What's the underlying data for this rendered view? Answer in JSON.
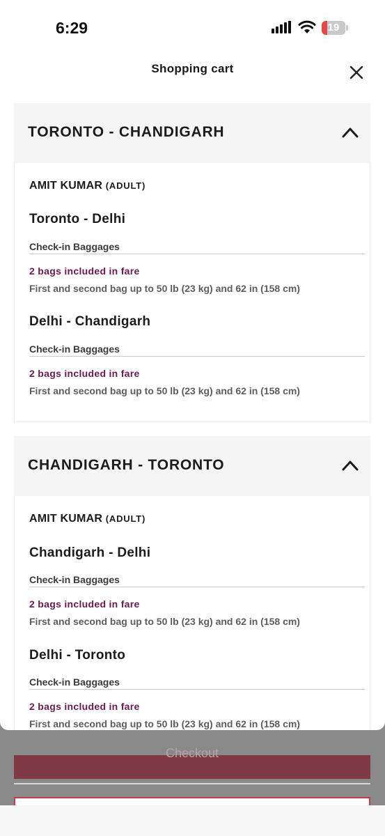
{
  "status_bar": {
    "time": "6:29",
    "battery": "19"
  },
  "sheet": {
    "title": "Shopping cart"
  },
  "sections": [
    {
      "route": "TORONTO - CHANDIGARH",
      "passenger": {
        "name": "AMIT KUMAR",
        "type": "(ADULT)"
      },
      "legs": [
        {
          "title": "Toronto - Delhi",
          "bag_label": "Check-in Baggages",
          "included": "2 bags included in fare",
          "detail": "First and second bag up to 50 lb (23 kg) and 62 in (158 cm)"
        },
        {
          "title": "Delhi - Chandigarh",
          "bag_label": "Check-in Baggages",
          "included": "2 bags included in fare",
          "detail": "First and second bag up to 50 lb (23 kg) and 62 in (158 cm)"
        }
      ]
    },
    {
      "route": "CHANDIGARH - TORONTO",
      "passenger": {
        "name": "AMIT KUMAR",
        "type": "(ADULT)"
      },
      "legs": [
        {
          "title": "Chandigarh - Delhi",
          "bag_label": "Check-in Baggages",
          "included": "2 bags included in fare",
          "detail": "First and second bag up to 50 lb (23 kg) and 62 in (158 cm)"
        },
        {
          "title": "Delhi - Toronto",
          "bag_label": "Check-in Baggages",
          "included": "2 bags included in fare",
          "detail": "First and second bag up to 50 lb (23 kg) and 62 in (158 cm)"
        }
      ]
    }
  ],
  "background": {
    "checkout_label": "Checkout"
  },
  "colors": {
    "accent": "#6b1a4f",
    "checkout": "#7f3a46",
    "outline": "#c43b4a"
  }
}
